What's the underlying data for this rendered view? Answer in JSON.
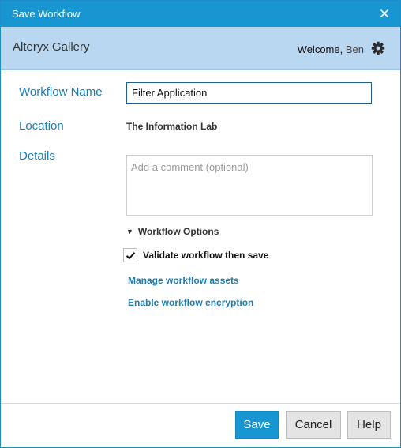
{
  "window": {
    "title": "Save Workflow",
    "close_icon": "close-icon"
  },
  "header": {
    "brand": "Alteryx Gallery",
    "welcome_prefix": "Welcome,",
    "user_name": "Ben",
    "settings_icon": "gear-icon"
  },
  "form": {
    "workflow_name_label": "Workflow Name",
    "workflow_name_value": "Filter Application",
    "location_label": "Location",
    "location_value": "The Information Lab",
    "details_label": "Details",
    "details_placeholder": "Add a comment (optional)",
    "details_value": ""
  },
  "options": {
    "toggle_label": "Workflow Options",
    "expanded": true,
    "validate_label": "Validate workflow then save",
    "validate_checked": true,
    "manage_assets_link": "Manage workflow assets",
    "encryption_link": "Enable workflow encryption"
  },
  "footer": {
    "save_label": "Save",
    "cancel_label": "Cancel",
    "help_label": "Help"
  },
  "colors": {
    "titlebar": "#1896d1",
    "header": "#b9d7f1",
    "label_blue": "#1e7db0",
    "primary_button": "#1896d1"
  }
}
